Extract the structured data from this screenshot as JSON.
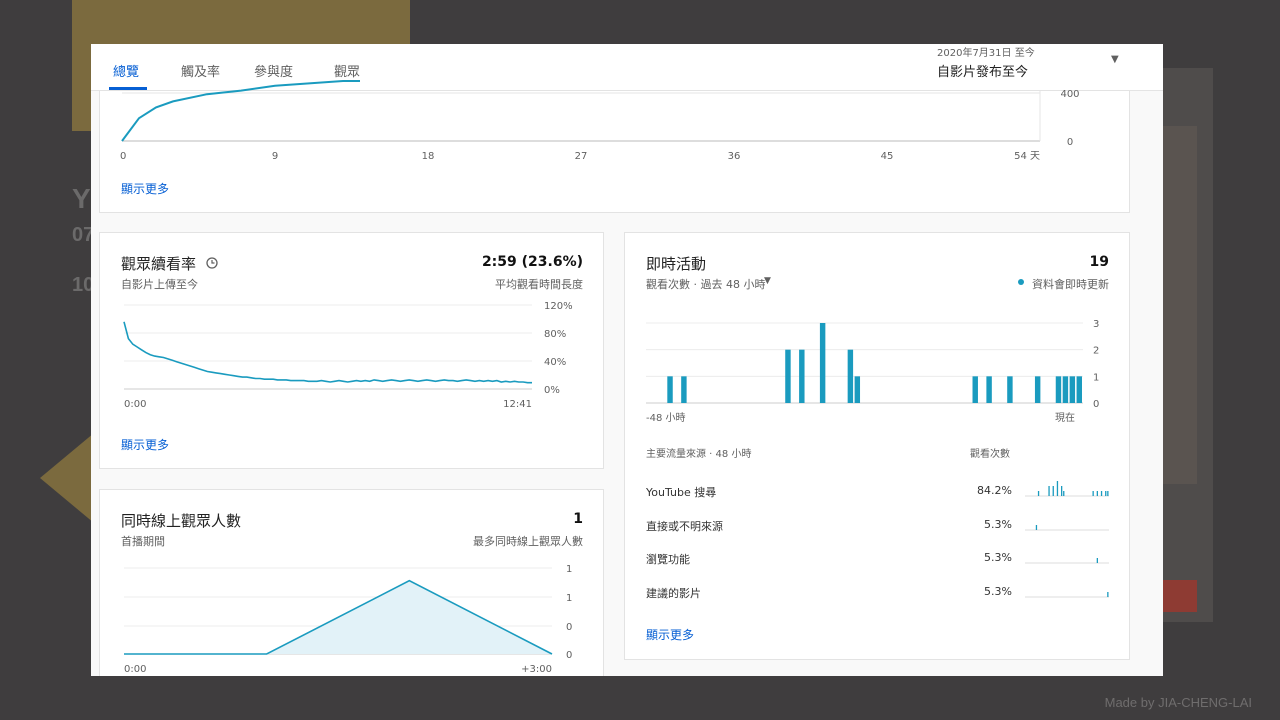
{
  "tabs": [
    {
      "label": "總覽",
      "active": true
    },
    {
      "label": "觸及率",
      "active": false
    },
    {
      "label": "參與度",
      "active": false
    },
    {
      "label": "觀眾",
      "active": false
    }
  ],
  "date_range": {
    "sub": "2020年7月31日 至今",
    "main": "自影片發布至今"
  },
  "top_card": {
    "show_more": "顯示更多",
    "chart_data": {
      "type": "line",
      "x": [
        0,
        1,
        2,
        3,
        5,
        7,
        9,
        11,
        13,
        14
      ],
      "y": [
        0,
        190,
        280,
        330,
        390,
        420,
        460,
        480,
        500,
        500
      ],
      "x_ticks": [
        "0",
        "9",
        "18",
        "27",
        "36",
        "45",
        "54 天"
      ],
      "y_ticks": [
        "0",
        "400"
      ],
      "xlim": [
        0,
        54
      ],
      "ylim": [
        0,
        500
      ],
      "color": "#1a9bbf"
    }
  },
  "retention_card": {
    "title": "觀眾續看率",
    "subtitle": "自影片上傳至今",
    "value": "2:59 (23.6%)",
    "value_label": "平均觀看時間長度",
    "show_more": "顯示更多",
    "chart_data": {
      "type": "line",
      "x_ticks": [
        "0:00",
        "12:41"
      ],
      "y_ticks": [
        "0%",
        "40%",
        "80%",
        "120%"
      ],
      "ylim": [
        0,
        120
      ],
      "y": [
        96,
        72,
        64,
        60,
        56,
        52,
        49,
        47,
        46,
        45,
        43,
        41,
        39,
        37,
        35,
        33,
        31,
        29,
        27,
        25,
        24,
        23,
        22,
        21,
        20,
        19,
        18,
        17,
        17,
        16,
        15,
        15,
        14,
        14,
        14,
        13,
        13,
        13,
        12,
        12,
        12,
        12,
        11,
        11,
        11,
        12,
        11,
        10,
        11,
        12,
        11,
        10,
        11,
        12,
        11,
        12,
        11,
        13,
        12,
        11,
        12,
        13,
        12,
        11,
        12,
        13,
        12,
        11,
        12,
        13,
        12,
        11,
        12,
        13,
        12,
        12,
        11,
        12,
        13,
        12,
        11,
        12,
        11,
        12,
        11,
        12,
        10,
        11,
        10,
        11,
        10,
        10,
        9,
        9
      ],
      "color": "#1a9bbf"
    }
  },
  "concurrent_card": {
    "title": "同時線上觀眾人數",
    "subtitle": "首播期間",
    "value": "1",
    "value_label": "最多同時線上觀眾人數",
    "chart_data": {
      "type": "area",
      "x": [
        0,
        1,
        2,
        3
      ],
      "y": [
        0,
        0,
        1,
        0
      ],
      "x_ticks": [
        "0:00",
        "+3:00"
      ],
      "y_ticks": [
        "0",
        "0",
        "1",
        "1"
      ],
      "ylim": [
        0,
        1.2
      ],
      "color": "#1a9bbf"
    }
  },
  "realtime_card": {
    "title": "即時活動",
    "value": "19",
    "subtitle": "觀看次數 · 過去 48 小時",
    "live_note": "資料會即時更新",
    "chart_data": {
      "type": "bar",
      "values": [
        0,
        0,
        0,
        1,
        0,
        1,
        0,
        0,
        0,
        0,
        0,
        0,
        0,
        0,
        0,
        0,
        0,
        0,
        0,
        0,
        2,
        0,
        2,
        0,
        0,
        3,
        0,
        0,
        0,
        2,
        1,
        0,
        0,
        0,
        0,
        0,
        0,
        0,
        0,
        0,
        0,
        0,
        0,
        0,
        0,
        0,
        0,
        1,
        0,
        1,
        0,
        0,
        1,
        0,
        0,
        0,
        1,
        0,
        0,
        1,
        1,
        1,
        1
      ],
      "x_ticks": [
        "-48 小時",
        "現在"
      ],
      "y_ticks": [
        "0",
        "1",
        "2",
        "3"
      ],
      "ylim": [
        0,
        3
      ],
      "color": "#1a9bbf"
    },
    "sources_header": "主要流量來源 · 48 小時",
    "views_header": "觀看次數",
    "sources": [
      {
        "name": "YouTube 搜尋",
        "pct": "84.2%",
        "spark": [
          0,
          0,
          0,
          0,
          0,
          0,
          1,
          0,
          0,
          0,
          0,
          2,
          0,
          2,
          0,
          3,
          0,
          2,
          1,
          0,
          0,
          0,
          0,
          0,
          0,
          0,
          0,
          0,
          0,
          0,
          0,
          0,
          1,
          0,
          1,
          0,
          1,
          0,
          1,
          1
        ]
      },
      {
        "name": "直接或不明來源",
        "pct": "5.3%",
        "spark": [
          0,
          0,
          0,
          0,
          0,
          1,
          0,
          0,
          0,
          0,
          0,
          0,
          0,
          0,
          0,
          0,
          0,
          0,
          0,
          0,
          0,
          0,
          0,
          0,
          0,
          0,
          0,
          0,
          0,
          0,
          0,
          0,
          0,
          0,
          0,
          0,
          0,
          0,
          0,
          0
        ]
      },
      {
        "name": "瀏覽功能",
        "pct": "5.3%",
        "spark": [
          0,
          0,
          0,
          0,
          0,
          0,
          0,
          0,
          0,
          0,
          0,
          0,
          0,
          0,
          0,
          0,
          0,
          0,
          0,
          0,
          0,
          0,
          0,
          0,
          0,
          0,
          0,
          0,
          0,
          0,
          0,
          0,
          0,
          0,
          1,
          0,
          0,
          0,
          0,
          0
        ]
      },
      {
        "name": "建議的影片",
        "pct": "5.3%",
        "spark": [
          0,
          0,
          0,
          0,
          0,
          0,
          0,
          0,
          0,
          0,
          0,
          0,
          0,
          0,
          0,
          0,
          0,
          0,
          0,
          0,
          0,
          0,
          0,
          0,
          0,
          0,
          0,
          0,
          0,
          0,
          0,
          0,
          0,
          0,
          0,
          0,
          0,
          0,
          0,
          1
        ]
      }
    ],
    "show_more": "顯示更多"
  },
  "credit": "Made by JIA-CHENG-LAI"
}
